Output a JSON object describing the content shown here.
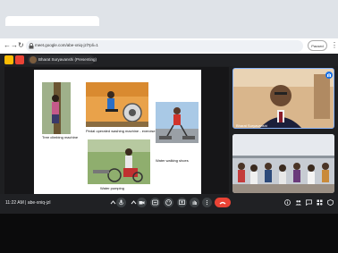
{
  "browser": {
    "url": "meet.google.com/abe-xniq-jzl?pli=1",
    "profile_label": "Paused"
  },
  "meet": {
    "presenter_label": "Bharat Suryavanshi (Presenting)",
    "time": "11:22 AM",
    "separator": "|",
    "meeting_code": "abe-xniq-jzl"
  },
  "slide": {
    "captions": {
      "tree": "Tree climbing machine",
      "pedal": "Pedal operated washing machine - exercise",
      "water_walk": "Water walking shoes",
      "pumping": "Water pumping"
    }
  },
  "participants": [
    {
      "name": "Bharat Suryavanshi"
    }
  ],
  "colors": {
    "hangup": "#ea4335",
    "meet_bg": "#202124",
    "active_border": "#8ab4f8"
  }
}
